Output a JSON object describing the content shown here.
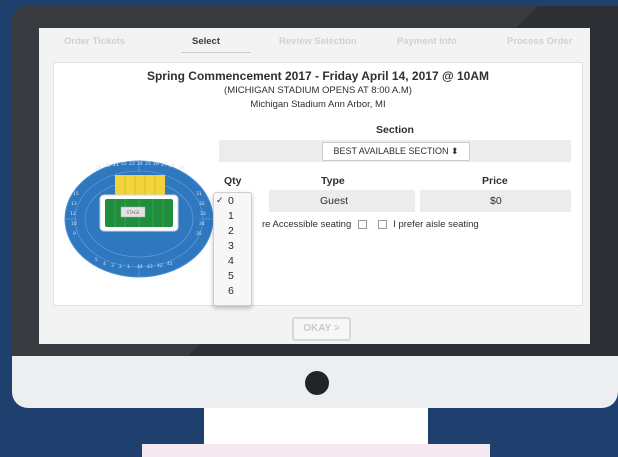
{
  "steps": [
    {
      "label": "Order Tickets"
    },
    {
      "label": "Select"
    },
    {
      "label": "Review Selection"
    },
    {
      "label": "Payment Info"
    },
    {
      "label": "Process Order"
    }
  ],
  "event": {
    "title": "Spring Commencement 2017 - Friday April 14, 2017 @ 10AM",
    "doors": "(MICHIGAN STADIUM OPENS AT 8:00 A.M)",
    "venue": "Michigan Stadium Ann Arbor, MI"
  },
  "section": {
    "label": "Section",
    "selected": "BEST AVAILABLE SECTION"
  },
  "table": {
    "headers": {
      "qty": "Qty",
      "type": "Type",
      "price": "Price"
    },
    "row": {
      "qty": "0",
      "type": "Guest",
      "price": "$0"
    }
  },
  "preferences": {
    "accessible": "re Accessible seating",
    "aisle": "I prefer aisle seating"
  },
  "qty_dropdown": {
    "options": [
      "0",
      "1",
      "2",
      "3",
      "4",
      "5",
      "6"
    ],
    "selected_index": 0
  },
  "map": {
    "stage_label": "STAGE"
  },
  "okay_label": "OKAY >",
  "colors": {
    "background": "#1f3f6e",
    "seats": "#2f78c0",
    "highlight": "#f2d43a",
    "field": "#1f8f3d"
  }
}
